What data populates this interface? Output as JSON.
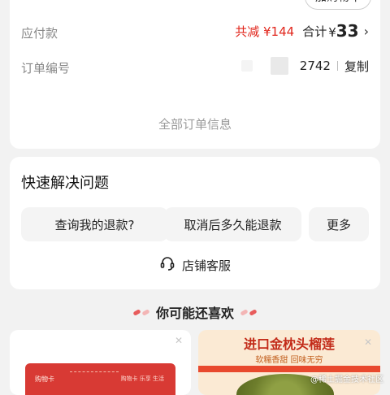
{
  "order": {
    "add_to_cart_label": "加购物车",
    "payable_label": "应付款",
    "discount_text": "共减 ¥144",
    "total_label": "合计",
    "total_currency": "¥",
    "total_value": "33",
    "order_no_label": "订单编号",
    "order_no_visible": "2742",
    "copy_label": "复制",
    "all_info_label": "全部订单信息"
  },
  "help": {
    "title": "快速解决问题",
    "quick_actions": [
      "查询我的退款?",
      "取消后多久能退款",
      "更多"
    ],
    "service_label": "店铺客服"
  },
  "recommend": {
    "header": "你可能还喜欢",
    "left_card": {
      "text1": "购物卡",
      "text2": "购物卡 乐享 生活"
    },
    "right_card": {
      "title": "进口金枕头榴莲",
      "subtitle": "软糯香甜 回味无穷"
    }
  },
  "watermark": "@稀土掘金技术社区",
  "colors": {
    "accent": "#e1251b",
    "background": "#f2f2f2"
  },
  "icons": {
    "chevron": "chevron-right-icon",
    "service": "headset-icon",
    "close": "close-icon"
  }
}
